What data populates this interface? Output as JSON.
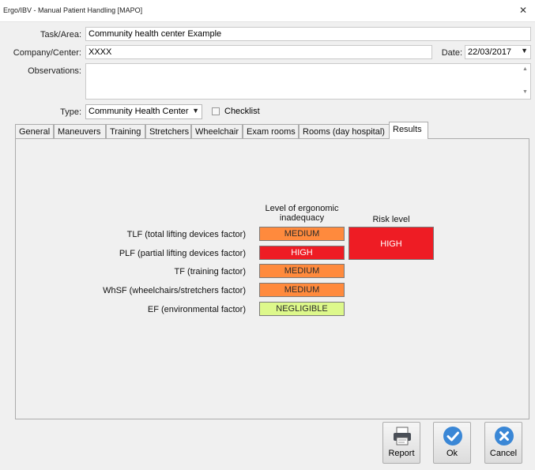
{
  "window": {
    "title": "Ergo/IBV - Manual Patient Handling [MAPO]",
    "close_glyph": "✕"
  },
  "form": {
    "task_label": "Task/Area:",
    "task_value": "Community health center Example",
    "company_label": "Company/Center:",
    "company_value": "XXXX",
    "date_label": "Date:",
    "date_value": "22/03/2017",
    "observations_label": "Observations:",
    "observations_value": "",
    "type_label": "Type:",
    "type_value": "Community Health Center",
    "checklist_label": "Checklist",
    "checklist_checked": false
  },
  "tabs": [
    {
      "label": "General"
    },
    {
      "label": "Maneuvers"
    },
    {
      "label": "Training"
    },
    {
      "label": "Stretchers"
    },
    {
      "label": "Wheelchair"
    },
    {
      "label": "Exam rooms"
    },
    {
      "label": "Rooms (day hospital)"
    },
    {
      "label": "Results"
    }
  ],
  "active_tab": "Results",
  "results": {
    "header_level_line1": "Level of ergonomic",
    "header_level_line2": "inadequacy",
    "header_risk": "Risk level",
    "rows": [
      {
        "label": "TLF (total lifting devices factor)",
        "level": "MEDIUM",
        "color": "#ff8a3d",
        "text_color": "#2b2b2b"
      },
      {
        "label": "PLF (partial lifting devices factor)",
        "level": "HIGH",
        "color": "#ee1c24",
        "text_color": "#ffffff"
      },
      {
        "label": "TF (training factor)",
        "level": "MEDIUM",
        "color": "#ff8a3d",
        "text_color": "#2b2b2b"
      },
      {
        "label": "WhSF (wheelchairs/stretchers factor)",
        "level": "MEDIUM",
        "color": "#ff8a3d",
        "text_color": "#2b2b2b"
      },
      {
        "label": "EF (environmental factor)",
        "level": "NEGLIGIBLE",
        "color": "#ddf88b",
        "text_color": "#2b2b2b"
      }
    ],
    "risk_level": "HIGH",
    "risk_color": "#ee1c24"
  },
  "buttons": {
    "report": {
      "label": "Report",
      "icon": "printer-icon"
    },
    "ok": {
      "label": "Ok",
      "icon": "checkmark-icon",
      "color": "#3a87d6"
    },
    "cancel": {
      "label": "Cancel",
      "icon": "close-icon",
      "color": "#3a87d6"
    }
  }
}
